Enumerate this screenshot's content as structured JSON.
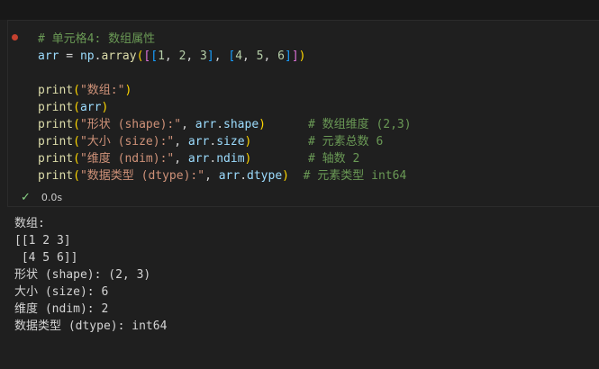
{
  "cell": {
    "lines": [
      [
        {
          "c": "tk-cm",
          "t": "# 单元格4: 数组属性"
        }
      ],
      [
        {
          "c": "tk-var",
          "t": "arr"
        },
        {
          "c": "tk-pl",
          "t": " = "
        },
        {
          "c": "tk-var",
          "t": "np"
        },
        {
          "c": "tk-pl",
          "t": "."
        },
        {
          "c": "tk-fn",
          "t": "array"
        },
        {
          "c": "tk-br1",
          "t": "("
        },
        {
          "c": "tk-br2",
          "t": "["
        },
        {
          "c": "tk-br3",
          "t": "["
        },
        {
          "c": "tk-num",
          "t": "1"
        },
        {
          "c": "tk-pl",
          "t": ", "
        },
        {
          "c": "tk-num",
          "t": "2"
        },
        {
          "c": "tk-pl",
          "t": ", "
        },
        {
          "c": "tk-num",
          "t": "3"
        },
        {
          "c": "tk-br3",
          "t": "]"
        },
        {
          "c": "tk-pl",
          "t": ", "
        },
        {
          "c": "tk-br3",
          "t": "["
        },
        {
          "c": "tk-num",
          "t": "4"
        },
        {
          "c": "tk-pl",
          "t": ", "
        },
        {
          "c": "tk-num",
          "t": "5"
        },
        {
          "c": "tk-pl",
          "t": ", "
        },
        {
          "c": "tk-num",
          "t": "6"
        },
        {
          "c": "tk-br3",
          "t": "]"
        },
        {
          "c": "tk-br2",
          "t": "]"
        },
        {
          "c": "tk-br1",
          "t": ")"
        }
      ],
      [],
      [
        {
          "c": "tk-fn",
          "t": "print"
        },
        {
          "c": "tk-br1",
          "t": "("
        },
        {
          "c": "tk-str",
          "t": "\"数组:\""
        },
        {
          "c": "tk-br1",
          "t": ")"
        }
      ],
      [
        {
          "c": "tk-fn",
          "t": "print"
        },
        {
          "c": "tk-br1",
          "t": "("
        },
        {
          "c": "tk-var",
          "t": "arr"
        },
        {
          "c": "tk-br1",
          "t": ")"
        }
      ],
      [
        {
          "c": "tk-fn",
          "t": "print"
        },
        {
          "c": "tk-br1",
          "t": "("
        },
        {
          "c": "tk-str",
          "t": "\"形状 (shape):\""
        },
        {
          "c": "tk-pl",
          "t": ", "
        },
        {
          "c": "tk-var",
          "t": "arr"
        },
        {
          "c": "tk-pl",
          "t": "."
        },
        {
          "c": "tk-var",
          "t": "shape"
        },
        {
          "c": "tk-br1",
          "t": ")"
        },
        {
          "c": "tk-pl",
          "t": "      "
        },
        {
          "c": "tk-cm",
          "t": "# 数组维度 (2,3)"
        }
      ],
      [
        {
          "c": "tk-fn",
          "t": "print"
        },
        {
          "c": "tk-br1",
          "t": "("
        },
        {
          "c": "tk-str",
          "t": "\"大小 (size):\""
        },
        {
          "c": "tk-pl",
          "t": ", "
        },
        {
          "c": "tk-var",
          "t": "arr"
        },
        {
          "c": "tk-pl",
          "t": "."
        },
        {
          "c": "tk-var",
          "t": "size"
        },
        {
          "c": "tk-br1",
          "t": ")"
        },
        {
          "c": "tk-pl",
          "t": "        "
        },
        {
          "c": "tk-cm",
          "t": "# 元素总数 6"
        }
      ],
      [
        {
          "c": "tk-fn",
          "t": "print"
        },
        {
          "c": "tk-br1",
          "t": "("
        },
        {
          "c": "tk-str",
          "t": "\"维度 (ndim):\""
        },
        {
          "c": "tk-pl",
          "t": ", "
        },
        {
          "c": "tk-var",
          "t": "arr"
        },
        {
          "c": "tk-pl",
          "t": "."
        },
        {
          "c": "tk-var",
          "t": "ndim"
        },
        {
          "c": "tk-br1",
          "t": ")"
        },
        {
          "c": "tk-pl",
          "t": "        "
        },
        {
          "c": "tk-cm",
          "t": "# 轴数 2"
        }
      ],
      [
        {
          "c": "tk-fn",
          "t": "print"
        },
        {
          "c": "tk-br1",
          "t": "("
        },
        {
          "c": "tk-str",
          "t": "\"数据类型 (dtype):\""
        },
        {
          "c": "tk-pl",
          "t": ", "
        },
        {
          "c": "tk-var",
          "t": "arr"
        },
        {
          "c": "tk-pl",
          "t": "."
        },
        {
          "c": "tk-var",
          "t": "dtype"
        },
        {
          "c": "tk-br1",
          "t": ")"
        },
        {
          "c": "tk-pl",
          "t": "  "
        },
        {
          "c": "tk-cm",
          "t": "# 元素类型 int64"
        }
      ]
    ]
  },
  "status": {
    "icon": "check-icon",
    "duration": "0.0s"
  },
  "output": {
    "lines": [
      "数组:",
      "[[1 2 3]",
      " [4 5 6]]",
      "形状 (shape): (2, 3)",
      "大小 (size): 6",
      "维度 (ndim): 2",
      "数据类型 (dtype): int64"
    ]
  },
  "colors": {
    "background": "#1f1f1f",
    "comment": "#6a9955",
    "variable": "#9cdcfe",
    "function": "#dcdcaa",
    "string": "#ce9178",
    "number": "#b5cea8",
    "success": "#89d185",
    "breakpoint": "#c5412f"
  }
}
